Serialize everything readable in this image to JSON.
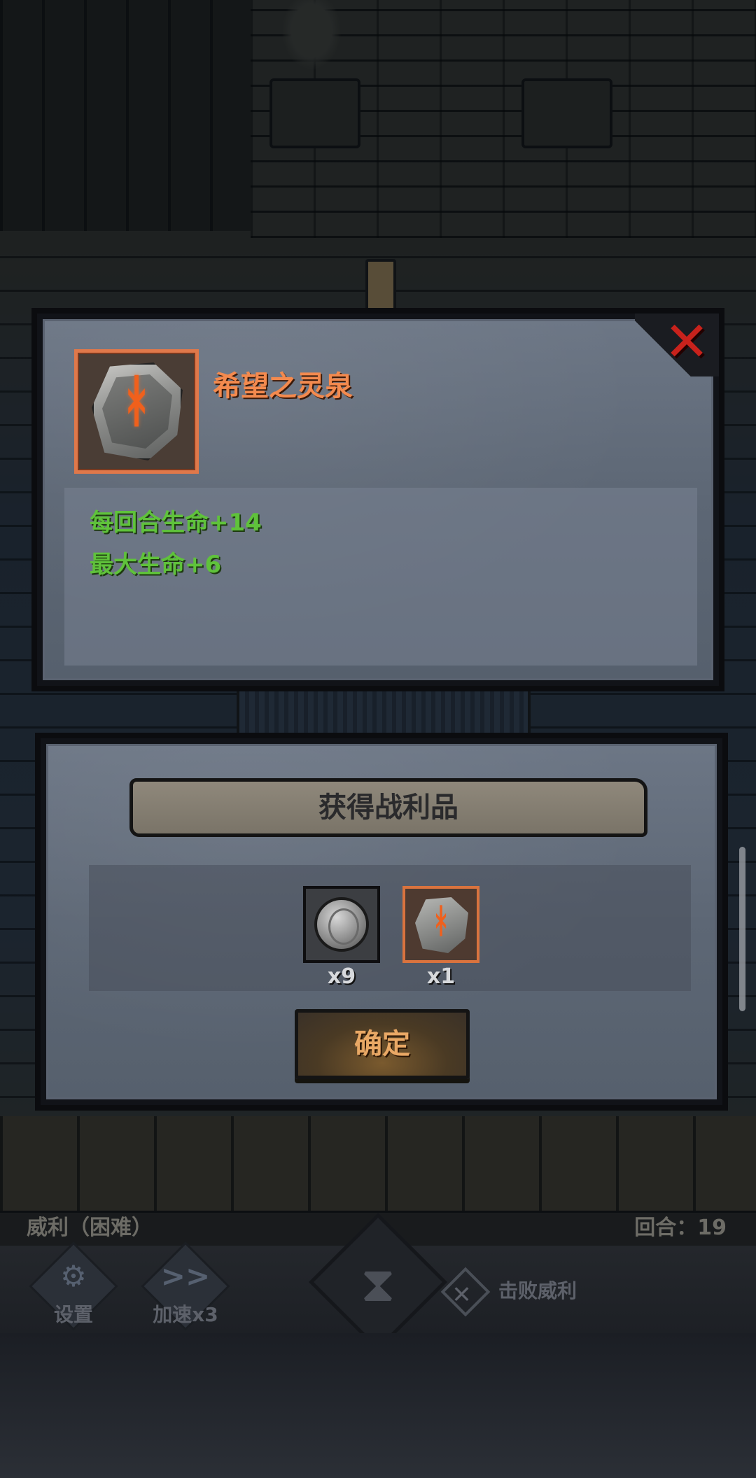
{
  "item_popup": {
    "name": "希望之灵泉",
    "stats": [
      "每回合生命+14",
      "最大生命+6"
    ],
    "close_icon": "close-x-icon",
    "item_icon": "rune-stone-icon"
  },
  "loot_popup": {
    "title": "获得战利品",
    "items": [
      {
        "icon": "silver-coin-icon",
        "count": "x9"
      },
      {
        "icon": "rune-stone-icon",
        "count": "x1"
      }
    ],
    "confirm_label": "确定"
  },
  "status_bar": {
    "left": "威利（困难）",
    "right": "回合：19"
  },
  "hud": {
    "settings_label": "设置",
    "speed_label": "加速x3",
    "defeat_label": "击败威利",
    "speed_icon_text": ">>"
  },
  "colors": {
    "item_name": "#f48a4e",
    "stat_text": "#5fc23b",
    "close_x": "#c8221c",
    "confirm_text": "#e9a865",
    "item_frame_border": "#e0784a"
  }
}
